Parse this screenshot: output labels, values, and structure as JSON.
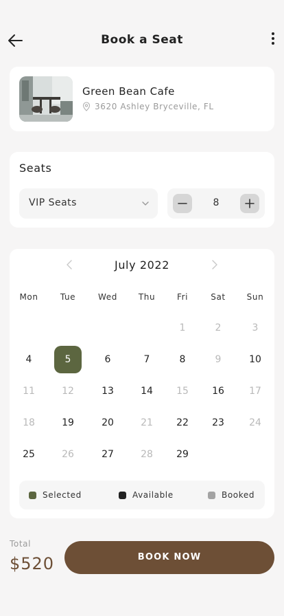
{
  "header": {
    "title": "Book a Seat",
    "back_icon": "arrow-left-icon",
    "menu_icon": "more-vertical-icon"
  },
  "cafe": {
    "name": "Green Bean Cafe",
    "address": "3620 Ashley Bryceville, FL",
    "address_icon": "location-pin-icon"
  },
  "seats": {
    "label": "Seats",
    "type_selected": "VIP Seats",
    "quantity": "8",
    "minus_icon": "minus-icon",
    "plus_icon": "plus-icon"
  },
  "calendar": {
    "month_label": "July 2022",
    "weekdays": [
      "Mon",
      "Tue",
      "Wed",
      "Thu",
      "Fri",
      "Sat",
      "Sun"
    ],
    "weeks": [
      [
        null,
        null,
        null,
        null,
        {
          "day": "1",
          "status": "booked"
        },
        {
          "day": "2",
          "status": "booked"
        },
        {
          "day": "3",
          "status": "booked"
        }
      ],
      [
        {
          "day": "4",
          "status": "available"
        },
        {
          "day": "5",
          "status": "selected"
        },
        {
          "day": "6",
          "status": "available"
        },
        {
          "day": "7",
          "status": "available"
        },
        {
          "day": "8",
          "status": "available"
        },
        {
          "day": "9",
          "status": "booked"
        },
        {
          "day": "10",
          "status": "available"
        }
      ],
      [
        {
          "day": "11",
          "status": "booked"
        },
        {
          "day": "12",
          "status": "booked"
        },
        {
          "day": "13",
          "status": "available"
        },
        {
          "day": "14",
          "status": "available"
        },
        {
          "day": "15",
          "status": "booked"
        },
        {
          "day": "16",
          "status": "available"
        },
        {
          "day": "17",
          "status": "booked"
        }
      ],
      [
        {
          "day": "18",
          "status": "booked"
        },
        {
          "day": "19",
          "status": "available"
        },
        {
          "day": "20",
          "status": "available"
        },
        {
          "day": "21",
          "status": "booked"
        },
        {
          "day": "22",
          "status": "available"
        },
        {
          "day": "23",
          "status": "available"
        },
        {
          "day": "24",
          "status": "booked"
        }
      ],
      [
        {
          "day": "25",
          "status": "available"
        },
        {
          "day": "26",
          "status": "booked"
        },
        {
          "day": "27",
          "status": "available"
        },
        {
          "day": "28",
          "status": "booked"
        },
        {
          "day": "29",
          "status": "available"
        },
        null,
        null
      ]
    ]
  },
  "legend": {
    "selected": {
      "label": "Selected",
      "color": "#5c6640"
    },
    "available": {
      "label": "Available",
      "color": "#222222"
    },
    "booked": {
      "label": "Booked",
      "color": "#a3a3a3"
    }
  },
  "footer": {
    "total_label": "Total",
    "total_value": "$520",
    "book_label": "BOOK NOW"
  },
  "colors": {
    "accent_brown": "#6d4f36",
    "selected_green": "#5c6640",
    "background": "#f6f5f5"
  }
}
